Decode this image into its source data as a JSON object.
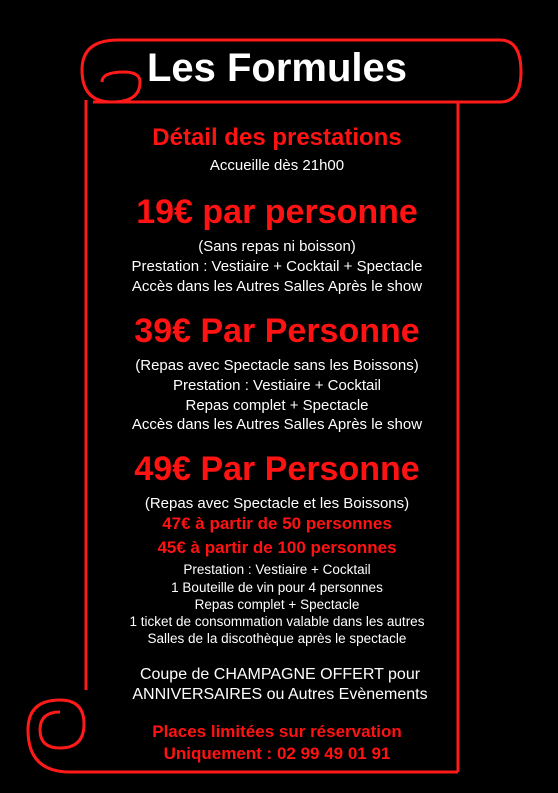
{
  "header": {
    "title": "Les Formules"
  },
  "section": {
    "heading": "Détail des prestations",
    "hours": "Accueille dès 21h00"
  },
  "formule1": {
    "price": "19€ par personne",
    "lines": [
      "(Sans repas ni boisson)",
      "Prestation : Vestiaire + Cocktail + Spectacle",
      "Accès dans les Autres Salles Après le show"
    ]
  },
  "formule2": {
    "price": "39€ Par Personne",
    "lines": [
      "(Repas avec Spectacle sans les Boissons)",
      "Prestation : Vestiaire + Cocktail",
      "Repas complet + Spectacle",
      "Accès dans les Autres Salles Après le show"
    ]
  },
  "formule3": {
    "price": "49€ Par Personne",
    "lines": [
      "(Repas avec Spectacle et les Boissons)"
    ],
    "discounts": [
      "47€ à partir de 50 personnes",
      "45€ à partir de 100 personnes"
    ],
    "details": [
      "Prestation : Vestiaire + Cocktail",
      "1 Bouteille de vin pour 4 personnes",
      "Repas complet + Spectacle",
      "1 ticket de consommation valable dans les autres",
      "Salles de la discothèque après le spectacle"
    ]
  },
  "offer": {
    "lines": [
      "Coupe de CHAMPAGNE OFFERT pour",
      "ANNIVERSAIRES ou Autres Evènements"
    ]
  },
  "footer": {
    "lines": [
      "Places limitées sur réservation",
      "Uniquement : 02 99 49 01 91"
    ]
  },
  "colors": {
    "background": "#000000",
    "accent": "#ff1212",
    "text": "#ffffff"
  }
}
